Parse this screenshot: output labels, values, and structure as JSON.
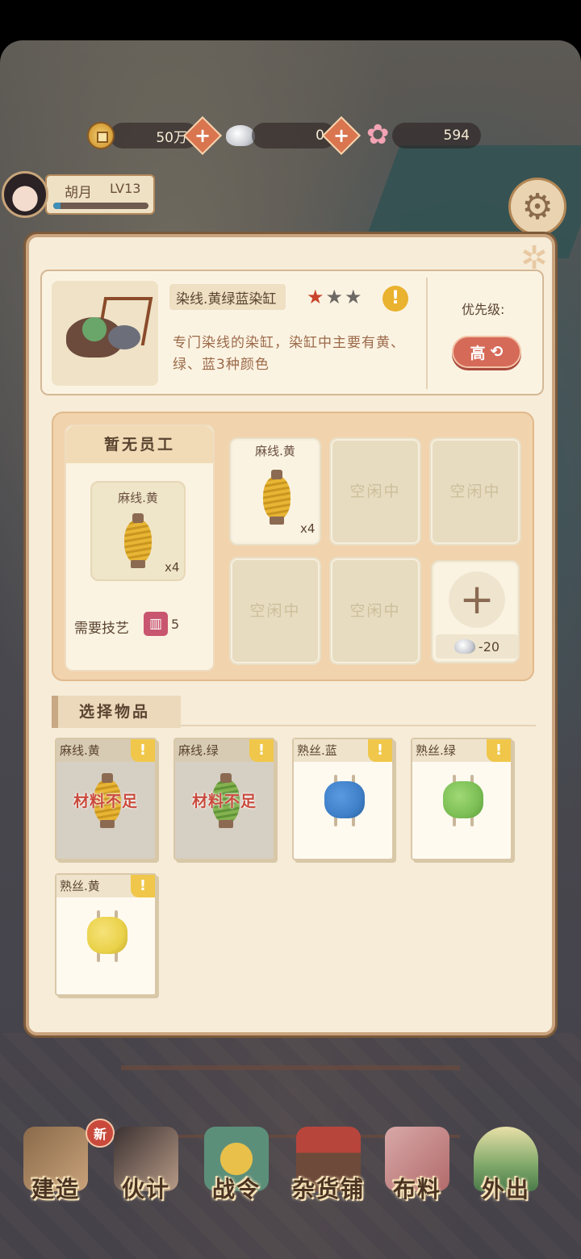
{
  "currency": {
    "coins": "50万",
    "silver": "0",
    "flowers": "594"
  },
  "player": {
    "name": "胡月",
    "level": "LV13",
    "xp_fraction": 0.08
  },
  "dialog": {
    "building": {
      "title": "染线.黄绿蓝染缸",
      "stars_filled": 1,
      "stars_total": 3,
      "description": "专门染线的染缸，染缸中主要有黄、绿、蓝3种颜色",
      "priority_label": "优先级:",
      "priority_value": "高"
    },
    "worker": {
      "header": "暂无员工",
      "item_name": "麻线.黄",
      "item_qty": "x4",
      "skill_label": "需要技艺",
      "skill_value": "5"
    },
    "slots": {
      "filled_item": "麻线.黄",
      "filled_qty": "x4",
      "idle_label": "空闲中",
      "add_cost": "-20"
    },
    "select_section": "选择物品",
    "items": [
      {
        "name": "麻线.黄",
        "status": "材料不足",
        "color": "#e3b231"
      },
      {
        "name": "麻线.绿",
        "status": "材料不足",
        "color": "#7aa84a"
      },
      {
        "name": "熟丝.蓝",
        "status": "",
        "color": "#3f80c9"
      },
      {
        "name": "熟丝.绿",
        "status": "",
        "color": "#7cbf55"
      },
      {
        "name": "熟丝.黄",
        "status": "",
        "color": "#ead24a"
      }
    ]
  },
  "nav": {
    "build": "建造",
    "staff": "伙计",
    "battle_pass": "战令",
    "shop": "杂货铺",
    "fabric": "布料",
    "outing": "外出",
    "new_badge": "新"
  }
}
